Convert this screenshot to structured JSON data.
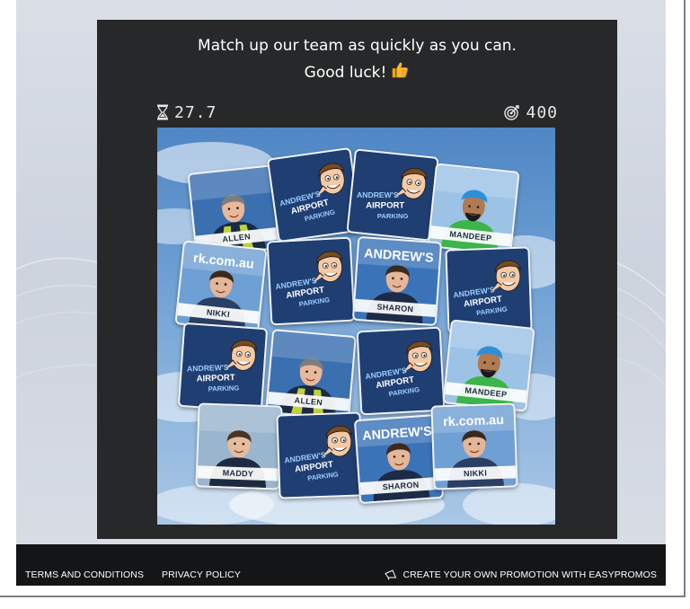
{
  "game": {
    "instruction_line1": "Match up our team as quickly as you can.",
    "instruction_line2": "Good luck!",
    "timer": "27.7",
    "score": "400",
    "card_back": {
      "line1": "ANDREW'S",
      "line2": "AIRPORT",
      "line3": "PARKING"
    },
    "cards": [
      {
        "state": "face",
        "name": "ALLEN"
      },
      {
        "state": "back",
        "name": ""
      },
      {
        "state": "back",
        "name": ""
      },
      {
        "state": "face",
        "name": "MANDEEP"
      },
      {
        "state": "face",
        "name": "NIKKI",
        "banner": "rk.com.au"
      },
      {
        "state": "back",
        "name": ""
      },
      {
        "state": "face",
        "name": "SHARON",
        "banner": "ANDREW'S"
      },
      {
        "state": "back",
        "name": ""
      },
      {
        "state": "back",
        "name": ""
      },
      {
        "state": "face",
        "name": "ALLEN"
      },
      {
        "state": "back",
        "name": ""
      },
      {
        "state": "face",
        "name": "MANDEEP"
      },
      {
        "state": "face",
        "name": "MADDY"
      },
      {
        "state": "back",
        "name": ""
      },
      {
        "state": "face",
        "name": "SHARON",
        "banner": "ANDREW'S"
      },
      {
        "state": "face",
        "name": "NIKKI",
        "banner": "rk.com.au"
      }
    ]
  },
  "footer": {
    "terms": "TERMS AND CONDITIONS",
    "privacy": "PRIVACY POLICY",
    "promo": "CREATE YOUR OWN PROMOTION WITH EASYPROMOS"
  },
  "icons": {
    "timer": "hourglass-icon",
    "score": "target-icon",
    "thumb": "thumbs-up-icon",
    "promo": "megaphone-icon"
  },
  "colors": {
    "panel": "#272829",
    "card_back": "#1f3f73",
    "footer": "#141516"
  }
}
